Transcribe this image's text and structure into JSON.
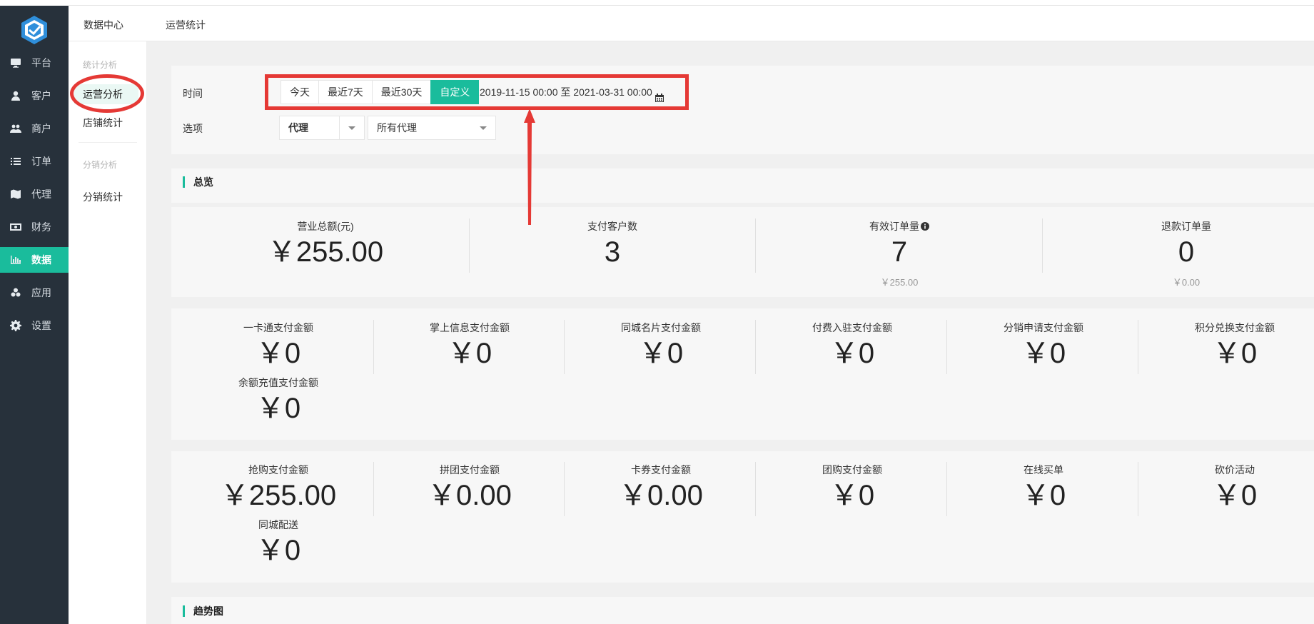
{
  "sidebar": {
    "items": [
      {
        "label": "平台",
        "icon": "monitor-icon"
      },
      {
        "label": "客户",
        "icon": "user-icon"
      },
      {
        "label": "商户",
        "icon": "users-icon"
      },
      {
        "label": "订单",
        "icon": "list-icon"
      },
      {
        "label": "代理",
        "icon": "map-icon"
      },
      {
        "label": "财务",
        "icon": "money-icon"
      },
      {
        "label": "数据",
        "icon": "bar-chart-icon",
        "active": true
      },
      {
        "label": "应用",
        "icon": "cubes-icon"
      },
      {
        "label": "设置",
        "icon": "gear-icon"
      }
    ]
  },
  "topbar": {
    "title": "数据中心",
    "subtitle": "运营统计"
  },
  "submenu": {
    "group1": "统计分析",
    "item_operations": "运营分析",
    "item_shop": "店铺统计",
    "group2": "分销分析",
    "item_distribution": "分销统计"
  },
  "filters": {
    "time_label": "时间",
    "buttons": [
      "今天",
      "最近7天",
      "最近30天",
      "自定义"
    ],
    "active_button": "自定义",
    "date_range": "2019-11-15 00:00 至 2021-03-31 00:00",
    "option_label": "选项",
    "select_type": "代理",
    "select_agent": "所有代理"
  },
  "overview": {
    "title": "总览",
    "stats": [
      {
        "label": "营业总额(元)",
        "value": "￥255.00"
      },
      {
        "label": "支付客户数",
        "value": "3"
      },
      {
        "label": "有效订单量",
        "value": "7",
        "sub": "￥255.00"
      },
      {
        "label": "退款订单量",
        "value": "0",
        "sub": "￥0.00"
      }
    ]
  },
  "payments1": [
    {
      "label": "一卡通支付金额",
      "value": "￥0"
    },
    {
      "label": "掌上信息支付金额",
      "value": "￥0"
    },
    {
      "label": "同城名片支付金额",
      "value": "￥0"
    },
    {
      "label": "付费入驻支付金额",
      "value": "￥0"
    },
    {
      "label": "分销申请支付金额",
      "value": "￥0"
    },
    {
      "label": "积分兑换支付金额",
      "value": "￥0"
    },
    {
      "label": "余额充值支付金额",
      "value": "￥0"
    }
  ],
  "payments2": [
    {
      "label": "抢购支付金额",
      "value": "￥255.00"
    },
    {
      "label": "拼团支付金额",
      "value": "￥0.00"
    },
    {
      "label": "卡券支付金额",
      "value": "￥0.00"
    },
    {
      "label": "团购支付金额",
      "value": "￥0"
    },
    {
      "label": "在线买单",
      "value": "￥0"
    },
    {
      "label": "砍价活动",
      "value": "￥0"
    },
    {
      "label": "同城配送",
      "value": "￥0"
    }
  ],
  "trend": {
    "title": "趋势图"
  },
  "colors": {
    "accent": "#1abc9c",
    "sidebar_bg": "#27313b",
    "annotation": "#e53935"
  }
}
